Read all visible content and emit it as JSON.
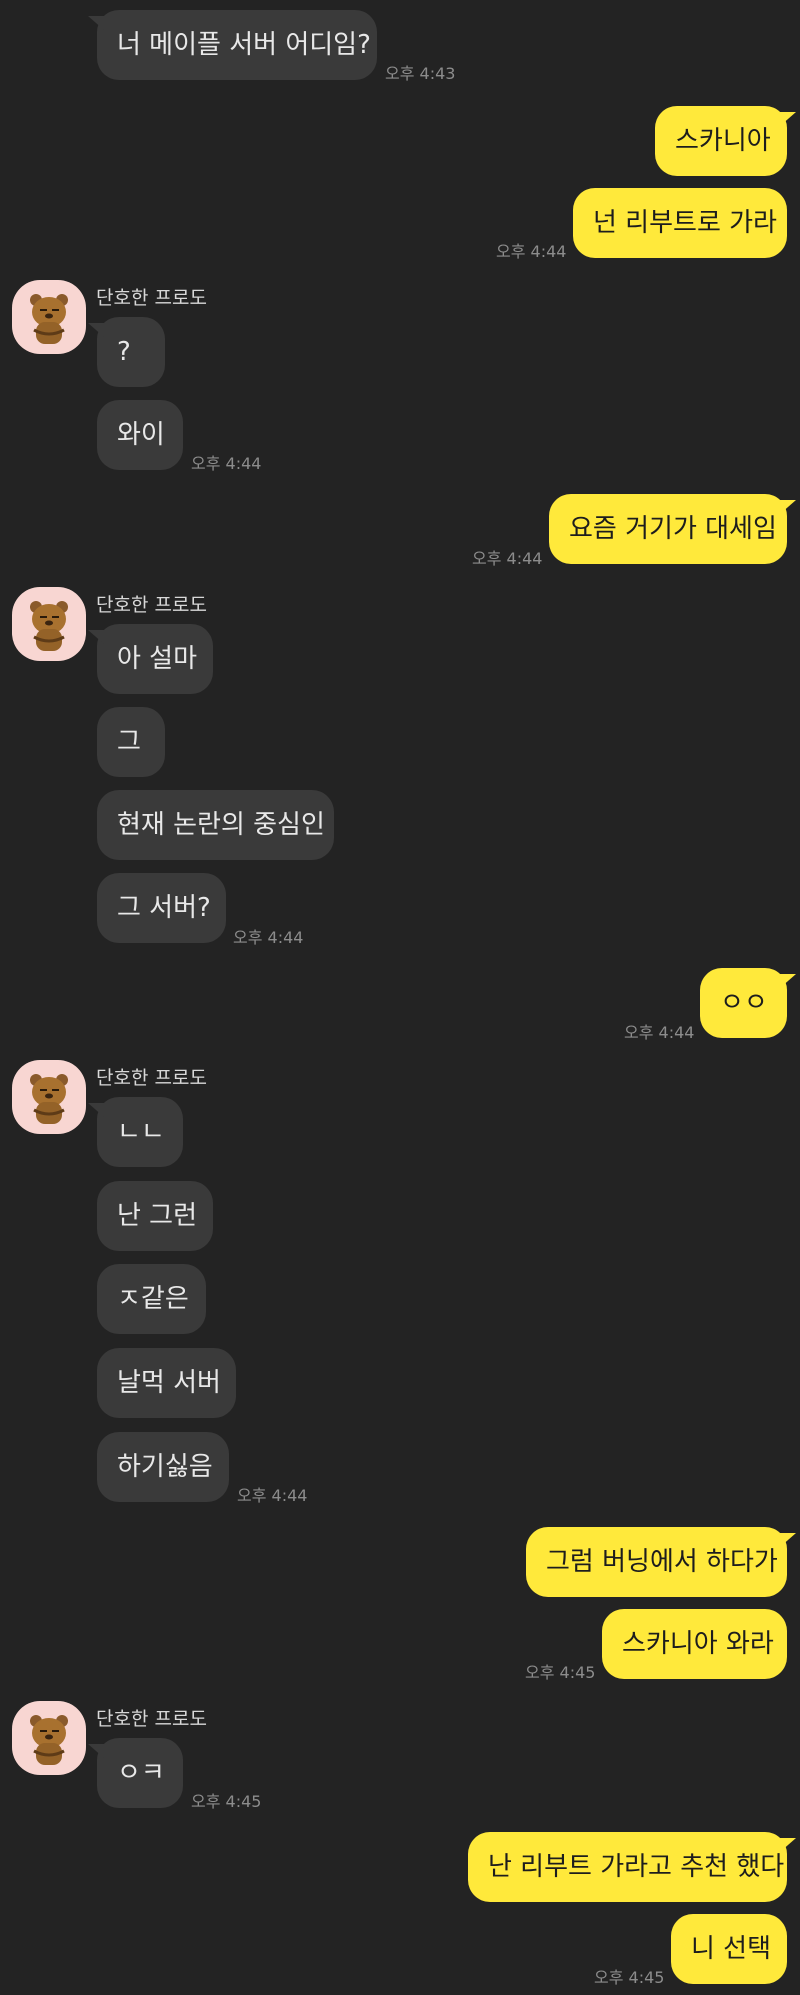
{
  "contact": {
    "name": "단호한 프로도"
  },
  "messages": [
    {
      "id": "m1",
      "dir": "in",
      "text": "너 메이플 서버 어디임?"
    },
    {
      "id": "t1",
      "time": "오후 4:43"
    },
    {
      "id": "m2",
      "dir": "out",
      "text": "스카니아"
    },
    {
      "id": "m3",
      "dir": "out",
      "text": "넌 리부트로 가라"
    },
    {
      "id": "t2",
      "time": "오후 4:44"
    },
    {
      "id": "m4",
      "dir": "in",
      "text": "?"
    },
    {
      "id": "m5",
      "dir": "in",
      "text": "와이"
    },
    {
      "id": "t3",
      "time": "오후 4:44"
    },
    {
      "id": "m6",
      "dir": "out",
      "text": "요즘 거기가 대세임"
    },
    {
      "id": "t4",
      "time": "오후 4:44"
    },
    {
      "id": "m7",
      "dir": "in",
      "text": "아 설마"
    },
    {
      "id": "m8",
      "dir": "in",
      "text": "그"
    },
    {
      "id": "m9",
      "dir": "in",
      "text": "현재 논란의 중심인"
    },
    {
      "id": "m10",
      "dir": "in",
      "text": "그 서버?"
    },
    {
      "id": "t5",
      "time": "오후 4:44"
    },
    {
      "id": "m11",
      "dir": "out",
      "text": "ㅇㅇ"
    },
    {
      "id": "t6",
      "time": "오후 4:44"
    },
    {
      "id": "m12",
      "dir": "in",
      "text": "ㄴㄴ"
    },
    {
      "id": "m13",
      "dir": "in",
      "text": "난 그런"
    },
    {
      "id": "m14",
      "dir": "in",
      "text": "ㅈ같은"
    },
    {
      "id": "m15",
      "dir": "in",
      "text": "날먹 서버"
    },
    {
      "id": "m16",
      "dir": "in",
      "text": "하기싫음"
    },
    {
      "id": "t7",
      "time": "오후 4:44"
    },
    {
      "id": "m17",
      "dir": "out",
      "text": "그럼 버닝에서 하다가"
    },
    {
      "id": "m18",
      "dir": "out",
      "text": "스카니아 와라"
    },
    {
      "id": "t8",
      "time": "오후 4:45"
    },
    {
      "id": "m19",
      "dir": "in",
      "text": "ㅇㅋ"
    },
    {
      "id": "t9",
      "time": "오후 4:45"
    },
    {
      "id": "m20",
      "dir": "out",
      "text": "난 리부트 가라고 추천 했다"
    },
    {
      "id": "m21",
      "dir": "out",
      "text": "니 선택"
    },
    {
      "id": "t10",
      "time": "오후 4:45"
    }
  ],
  "colors": {
    "background": "#232323",
    "incoming_bubble": "#3a3a3a",
    "outgoing_bubble": "#ffe93b",
    "avatar_bg": "#f8d6d2"
  },
  "icons": {
    "avatar": "frodo-character-icon"
  }
}
